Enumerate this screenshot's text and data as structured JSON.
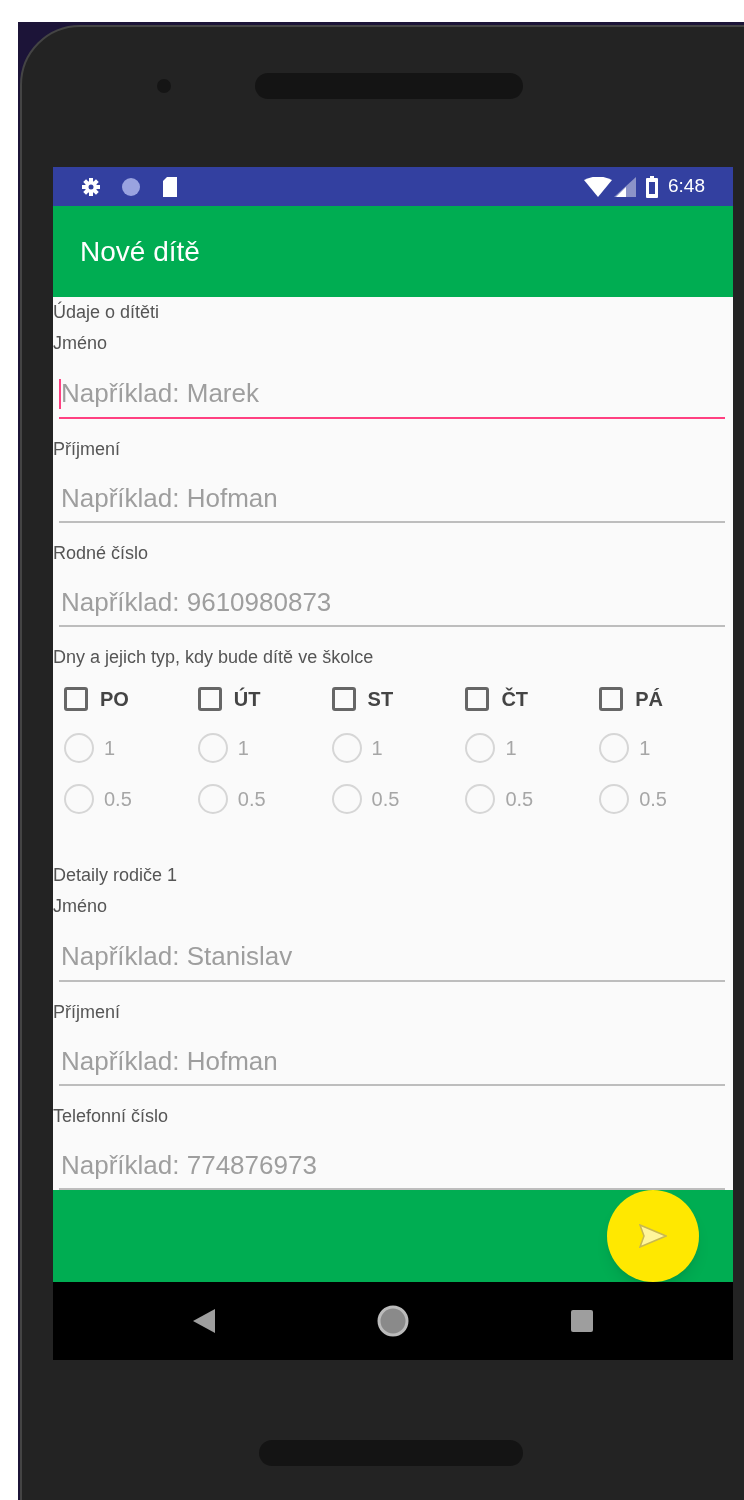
{
  "status_bar": {
    "time": "6:48"
  },
  "app_bar": {
    "title": "Nové dítě"
  },
  "child": {
    "heading": "Údaje o dítěti",
    "fields": [
      {
        "label": "Jméno",
        "placeholder": "Například: Marek",
        "focused": true
      },
      {
        "label": "Příjmení",
        "placeholder": "Například: Hofman",
        "focused": false
      },
      {
        "label": "Rodné číslo",
        "placeholder": "Například: 9610980873",
        "focused": false
      }
    ]
  },
  "attendance": {
    "label": "Dny a jejich typ, kdy bude dítě ve školce",
    "days": [
      {
        "label": "PO",
        "checked": false,
        "options": [
          {
            "label": "1",
            "selected": false,
            "disabled": true
          },
          {
            "label": "0.5",
            "selected": false,
            "disabled": true
          }
        ]
      },
      {
        "label": "ÚT",
        "checked": false,
        "options": [
          {
            "label": "1",
            "selected": false,
            "disabled": true
          },
          {
            "label": "0.5",
            "selected": false,
            "disabled": true
          }
        ]
      },
      {
        "label": "ST",
        "checked": false,
        "options": [
          {
            "label": "1",
            "selected": false,
            "disabled": true
          },
          {
            "label": "0.5",
            "selected": false,
            "disabled": true
          }
        ]
      },
      {
        "label": "ČT",
        "checked": false,
        "options": [
          {
            "label": "1",
            "selected": false,
            "disabled": true
          },
          {
            "label": "0.5",
            "selected": false,
            "disabled": true
          }
        ]
      },
      {
        "label": "PÁ",
        "checked": false,
        "options": [
          {
            "label": "1",
            "selected": false,
            "disabled": true
          },
          {
            "label": "0.5",
            "selected": false,
            "disabled": true
          }
        ]
      }
    ]
  },
  "parent": {
    "heading": "Detaily rodiče 1",
    "fields": [
      {
        "label": "Jméno",
        "placeholder": "Například: Stanislav",
        "focused": false
      },
      {
        "label": "Příjmení",
        "placeholder": "Například: Hofman",
        "focused": false
      },
      {
        "label": "Telefonní číslo",
        "placeholder": "Například: 774876973",
        "focused": false
      }
    ]
  }
}
